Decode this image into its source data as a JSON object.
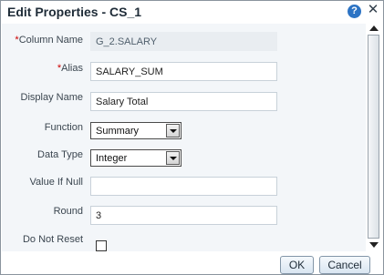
{
  "dialog": {
    "title": "Edit Properties - CS_1",
    "help_icon": "help-icon",
    "close_icon": "close-icon"
  },
  "form": {
    "column_name": {
      "required_mark": "*",
      "label": "Column Name",
      "value": "G_2.SALARY"
    },
    "alias": {
      "required_mark": "*",
      "label": "Alias",
      "value": "SALARY_SUM"
    },
    "display_name": {
      "label": "Display Name",
      "value": "Salary Total"
    },
    "function": {
      "label": "Function",
      "value": "Summary"
    },
    "data_type": {
      "label": "Data Type",
      "value": "Integer"
    },
    "value_if_null": {
      "label": "Value If Null",
      "value": ""
    },
    "round": {
      "label": "Round",
      "value": "3"
    },
    "do_not_reset": {
      "label": "Do Not Reset",
      "checked": false
    }
  },
  "buttons": {
    "ok": "OK",
    "cancel": "Cancel"
  }
}
